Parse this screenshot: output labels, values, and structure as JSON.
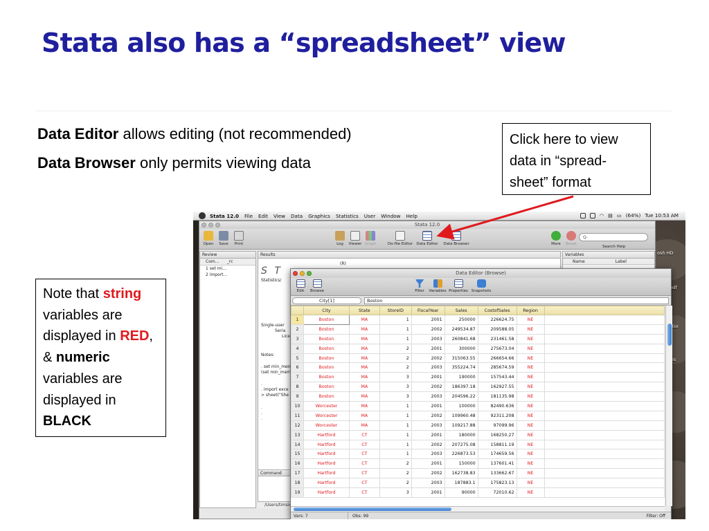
{
  "slide": {
    "title": "Stata also has a “spreadsheet” view",
    "bullets": [
      {
        "bold": "Data Editor",
        "rest": " allows editing (not recommended)"
      },
      {
        "bold": "Data Browser",
        "rest": " only permits viewing data"
      }
    ],
    "callout": "Click here to view data in “spread-sheet” format",
    "note": {
      "p1": "Note that ",
      "string": "string",
      "p2": " variables are displayed in ",
      "red": "RED",
      "p3": ", & ",
      "numeric": "numeric",
      "p4": " variables are displayed in ",
      "black": "BLACK"
    },
    "colors": {
      "title": "#1f1f9e",
      "string_red": "#e0191e",
      "arrow": "#e0191e"
    }
  },
  "mac": {
    "app_name": "Stata 12.0",
    "menus": [
      "File",
      "Edit",
      "View",
      "Data",
      "Graphics",
      "Statistics",
      "User",
      "Window",
      "Help"
    ],
    "battery": "(64%)",
    "clock": "Tue 10:53 AM",
    "desktop_labels": [
      "osh HD",
      ".pdf",
      "xlsx",
      "es"
    ]
  },
  "stata_window": {
    "title": "Stata 12.0",
    "toolbar_left": [
      "Open",
      "Save",
      "Print"
    ],
    "toolbar_mid": [
      "Log",
      "Viewer",
      "Graph",
      "Do-file Editor",
      "Data Editor",
      "Data Browser"
    ],
    "toolbar_right": [
      "More",
      "Break"
    ],
    "search_placeholder": "Q-",
    "search_help": "Search Help",
    "review": {
      "title": "Review",
      "columns": [
        "Com...",
        "_rc"
      ],
      "items": [
        "1 set mi...",
        "2 import..."
      ]
    },
    "results": {
      "title": "Results",
      "lines": [
        "(R)",
        "Statistics/",
        "Single-user",
        "Seria",
        "Lice",
        "Notes:",
        ". set min_mem",
        "(set min_mem",
        ".",
        ". import exce",
        "> sheet(\"She",
        ".",
        ".",
        "."
      ]
    },
    "variables": {
      "title": "Variables",
      "columns": [
        "Name",
        "Label"
      ]
    },
    "command_title": "Command",
    "cwd": "/Users/timsimm"
  },
  "data_browser": {
    "title": "Data Editor (Browse)",
    "toolbar_left": [
      "Edit",
      "Browse"
    ],
    "toolbar_right": [
      "Filter",
      "Variables",
      "Properties",
      "Snapshots"
    ],
    "cell_name": "City[1]",
    "cell_value": "Boston",
    "columns": [
      "City",
      "State",
      "StoreID",
      "FiscalYear",
      "Sales",
      "CostofSales",
      "Region"
    ],
    "rows": [
      [
        "1",
        "Boston",
        "MA",
        "1",
        "2001",
        "250000",
        "226624.75",
        "NE"
      ],
      [
        "2",
        "Boston",
        "MA",
        "1",
        "2002",
        "249534.87",
        "209588.05",
        "NE"
      ],
      [
        "3",
        "Boston",
        "MA",
        "1",
        "2003",
        "260841.68",
        "231461.58",
        "NE"
      ],
      [
        "4",
        "Boston",
        "MA",
        "2",
        "2001",
        "300000",
        "275673.04",
        "NE"
      ],
      [
        "5",
        "Boston",
        "MA",
        "2",
        "2002",
        "315063.55",
        "266654.66",
        "NE"
      ],
      [
        "6",
        "Boston",
        "MA",
        "2",
        "2003",
        "355224.74",
        "285674.59",
        "NE"
      ],
      [
        "7",
        "Boston",
        "MA",
        "3",
        "2001",
        "190000",
        "157543.44",
        "NE"
      ],
      [
        "8",
        "Boston",
        "MA",
        "3",
        "2002",
        "186397.18",
        "162927.55",
        "NE"
      ],
      [
        "9",
        "Boston",
        "MA",
        "3",
        "2003",
        "204596.22",
        "181135.98",
        "NE"
      ],
      [
        "10",
        "Worcester",
        "MA",
        "1",
        "2001",
        "100000",
        "82490.636",
        "NE"
      ],
      [
        "11",
        "Worcester",
        "MA",
        "1",
        "2002",
        "109960.48",
        "92311.208",
        "NE"
      ],
      [
        "12",
        "Worcester",
        "MA",
        "1",
        "2003",
        "109217.88",
        "97099.96",
        "NE"
      ],
      [
        "13",
        "Hartford",
        "CT",
        "1",
        "2001",
        "180000",
        "168250.27",
        "NE"
      ],
      [
        "14",
        "Hartford",
        "CT",
        "1",
        "2002",
        "207275.08",
        "158811.19",
        "NE"
      ],
      [
        "15",
        "Hartford",
        "CT",
        "1",
        "2003",
        "226873.53",
        "174659.56",
        "NE"
      ],
      [
        "16",
        "Hartford",
        "CT",
        "2",
        "2001",
        "150000",
        "137601.41",
        "NE"
      ],
      [
        "17",
        "Hartford",
        "CT",
        "2",
        "2002",
        "162738.83",
        "133662.67",
        "NE"
      ],
      [
        "18",
        "Hartford",
        "CT",
        "2",
        "2003",
        "187883.1",
        "175823.13",
        "NE"
      ],
      [
        "19",
        "Hartford",
        "CT",
        "3",
        "2001",
        "90000",
        "72010.62",
        "NE"
      ]
    ],
    "string_columns": [
      0,
      1,
      6
    ],
    "status": {
      "vars": "Vars: 7",
      "obs": "Obs: 99",
      "filter": "Filter: Off"
    }
  }
}
